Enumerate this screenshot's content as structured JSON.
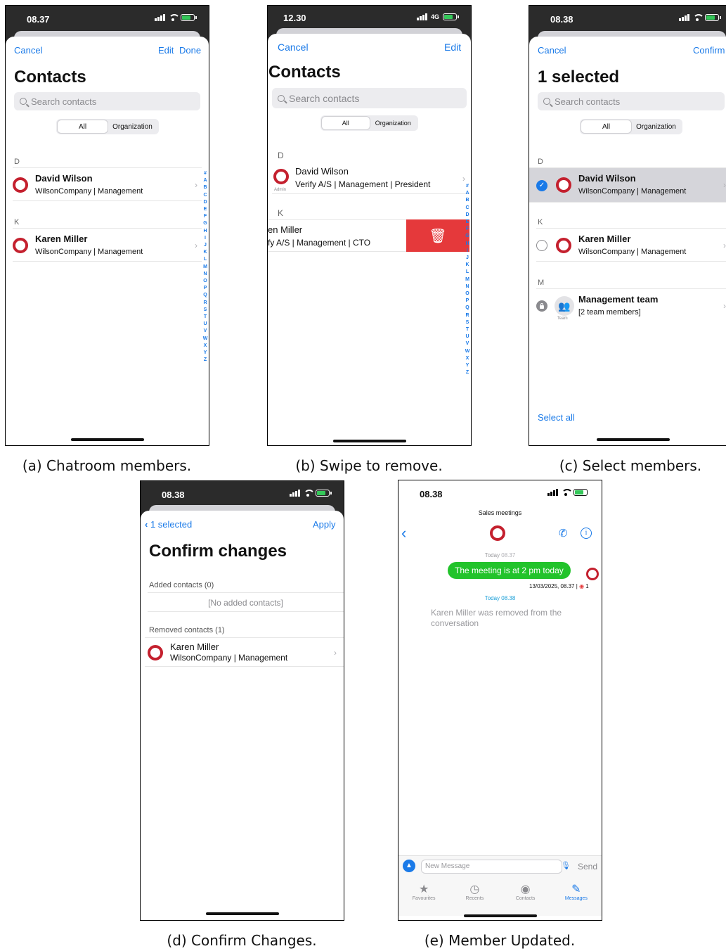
{
  "colors": {
    "accent": "#1a7ae8",
    "brand_ring": "#c4202e",
    "bubble_green": "#22c32b",
    "delete_red": "#e5393b"
  },
  "captions": {
    "a": "(a) Chatroom members.",
    "b": "(b) Swipe to remove.",
    "c": "(c) Select members.",
    "d": "(d) Confirm Changes.",
    "e": "(e) Member Updated."
  },
  "index_letters": [
    "#",
    "A",
    "B",
    "C",
    "D",
    "E",
    "F",
    "G",
    "H",
    "I",
    "J",
    "K",
    "L",
    "M",
    "N",
    "O",
    "P",
    "Q",
    "R",
    "S",
    "T",
    "U",
    "V",
    "W",
    "X",
    "Y",
    "Z"
  ],
  "screen_a": {
    "time": "08.37",
    "cancel": "Cancel",
    "edit": "Edit",
    "done": "Done",
    "title": "Contacts",
    "search_placeholder": "Search contacts",
    "seg_all": "All",
    "seg_org": "Organization",
    "sections": [
      {
        "letter": "D",
        "name": "David Wilson",
        "sub": "WilsonCompany | Management"
      },
      {
        "letter": "K",
        "name": "Karen Miller",
        "sub": "WilsonCompany | Management"
      }
    ]
  },
  "screen_b": {
    "time": "12.30",
    "network": "4G",
    "cancel": "Cancel",
    "edit": "Edit",
    "title": "Contacts",
    "search_placeholder": "Search contacts",
    "seg_all": "All",
    "seg_org": "Organization",
    "sections": [
      {
        "letter": "D",
        "name": "David Wilson",
        "sub": "Verify A/S | Management | President",
        "badge": "Admin"
      },
      {
        "letter": "K",
        "name": "en Miller",
        "sub": "fy A/S | Management | CTO"
      }
    ]
  },
  "screen_c": {
    "time": "08.38",
    "cancel": "Cancel",
    "confirm": "Confirm",
    "title": "1 selected",
    "search_placeholder": "Search contacts",
    "seg_all": "All",
    "seg_org": "Organization",
    "sections": [
      {
        "letter": "D",
        "name": "David Wilson",
        "sub": "WilsonCompany | Management",
        "selected": true
      },
      {
        "letter": "K",
        "name": "Karen Miller",
        "sub": "WilsonCompany | Management",
        "selected": false
      },
      {
        "letter": "M",
        "name": "Management team",
        "sub": "[2 team members]",
        "badge": "Team"
      }
    ],
    "select_all": "Select all"
  },
  "screen_d": {
    "time": "08.38",
    "back": "1 selected",
    "apply": "Apply",
    "title": "Confirm changes",
    "added_header": "Added contacts (0)",
    "added_empty": "[No added contacts]",
    "removed_header": "Removed contacts (1)",
    "removed": {
      "name": "Karen Miller",
      "sub": "WilsonCompany | Management"
    }
  },
  "screen_e": {
    "time": "08.38",
    "chat_title": "Sales meetings",
    "day1_label": "Today",
    "day1_time": "08.37",
    "message": "The meeting is at 2 pm today",
    "message_meta": "13/03/2025, 08.37",
    "read_count": "1",
    "day2_label": "Today",
    "day2_time": "08.38",
    "system_message": "Karen Miller was removed from the conversation",
    "input_placeholder": "New Message",
    "send": "Send",
    "tabs": [
      {
        "label": "Favourites",
        "icon": "star-icon",
        "glyph": "★",
        "active": false
      },
      {
        "label": "Recents",
        "icon": "clock-icon",
        "glyph": "◷",
        "active": false
      },
      {
        "label": "Contacts",
        "icon": "person-icon",
        "glyph": "◉",
        "active": false
      },
      {
        "label": "Messages",
        "icon": "compose-icon",
        "glyph": "✎",
        "active": true
      }
    ]
  }
}
